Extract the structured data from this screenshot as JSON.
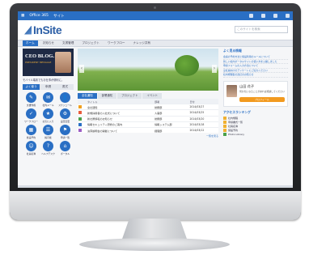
{
  "topbar": {
    "left": "Office 365",
    "site": "サイト"
  },
  "header": {
    "logo": "InSite",
    "search_placeholder": "このサイトを検索"
  },
  "nav": [
    "ホーム",
    "お知らせ",
    "文書管理",
    "プロジェクト",
    "ワークフロー",
    "ナレッジ共有"
  ],
  "left": {
    "blog_title": "CEO BLOG.",
    "blog_sub": "PRESIDENT MESSAGE",
    "caption": "モバイル端末でもお仕事が便利に。",
    "tabs": [
      "よく使う",
      "申請",
      "書式"
    ],
    "icons": [
      {
        "glyph": "✎",
        "label": "文書作成"
      },
      {
        "glyph": "✉",
        "label": "社内メール"
      },
      {
        "glyph": "👤",
        "label": "スケジュール"
      },
      {
        "glyph": "✓",
        "label": "ワークフロー"
      },
      {
        "glyph": "★",
        "label": "お気に入り"
      },
      {
        "glyph": "⚙",
        "label": "設定変更"
      },
      {
        "glyph": "▦",
        "label": "施設予約"
      },
      {
        "glyph": "☰",
        "label": "掲示板"
      },
      {
        "glyph": "⚑",
        "label": "申請一覧"
      },
      {
        "glyph": "☺",
        "label": "社員名簿"
      },
      {
        "glyph": "?",
        "label": "ヘルプデスク"
      },
      {
        "glyph": "⌂",
        "label": "ポータル"
      }
    ]
  },
  "main": {
    "tabs": [
      "全社通知",
      "部署通知",
      "プロジェクト",
      "イベント"
    ],
    "table": {
      "headers": [
        "",
        "タイトル",
        "部署",
        "日付"
      ],
      "rows": [
        {
          "color": "#f0a020",
          "title": "全社通知",
          "dept": "総務部",
          "date": "2014/03/27"
        },
        {
          "color": "#e85c3c",
          "title": "新規採用者の入社式について",
          "dept": "人事部",
          "date": "2014/03/25"
        },
        {
          "color": "#4aa04a",
          "title": "新社屋移転のお知らせ",
          "dept": "総務部",
          "date": "2014/03/20"
        },
        {
          "color": "#2a6fc4",
          "title": "情報セキュリティ研修のご案内",
          "dept": "情報システム部",
          "date": "2014/03/18"
        },
        {
          "color": "#9c5ec4",
          "title": "決算説明会の開催について",
          "dept": "経理部",
          "date": "2014/03/12"
        }
      ],
      "more": "一覧を見る"
    }
  },
  "right": {
    "news_title": "よく見る情報",
    "news": [
      "会議の予約方法と施設利用のルールについて",
      "新しい社内ポータルサイトの使い方を公開しました",
      "申請フォームの入力方法について",
      "全社員向けのアンケートにご協力ください",
      "社内規程集の改訂のお知らせ"
    ],
    "profile_name": "山田 花子",
    "profile_msg": "何か気になることがあれば相談してください",
    "profile_btn": "プロフィール",
    "rank_title": "アクセスランキング",
    "rank": [
      "社内規程",
      "申請書式一覧",
      "社員名簿",
      "施設予約",
      "Photo Library"
    ]
  }
}
